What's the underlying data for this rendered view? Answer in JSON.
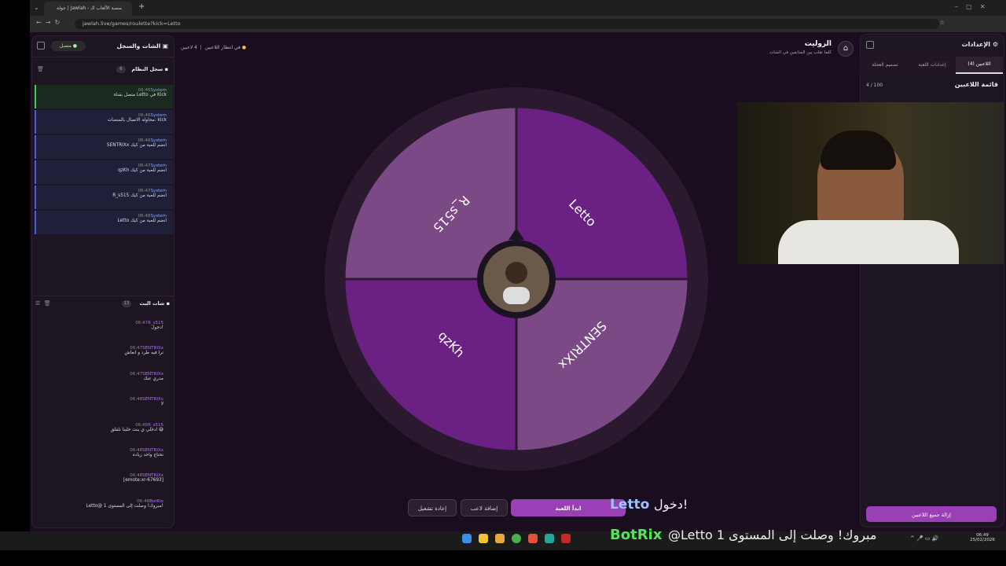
{
  "browser": {
    "tab_title": "جولة | Jawlah - منصة الألعاب الـ",
    "url": "jawlah.live/games/roulette?kick=Letto"
  },
  "left": {
    "title": "الشات والسجل",
    "status": "متصل",
    "system_log": {
      "title": "سجل النظام",
      "count": "6",
      "entries": [
        {
          "author": "System",
          "time": "06:46",
          "text": "متصل بقناة Letto في Kick"
        },
        {
          "author": "System",
          "time": "06:46",
          "text": "محاولة الاتصال بالمنصات: kick"
        },
        {
          "author": "System",
          "time": "06:46",
          "text": "SENTRIXx انضم للعبة من كيك"
        },
        {
          "author": "System",
          "time": "06:47",
          "text": "qzKh انضم للعبة من كيك"
        },
        {
          "author": "System",
          "time": "06:47",
          "text": "R_s515 انضم للعبة من كيك"
        },
        {
          "author": "System",
          "time": "06:48",
          "text": "Letto انضم للعبة من كيك"
        }
      ]
    },
    "live_chat": {
      "title": "شات البث",
      "count": "13",
      "messages": [
        {
          "user": "R_s515",
          "time": "06:47",
          "text": "دخول!"
        },
        {
          "user": "SENTRIXx",
          "time": "06:47",
          "text": "ترا فيه طرد و انعاش"
        },
        {
          "user": "SENTRIXx",
          "time": "06:47",
          "text": "مدري عنك"
        },
        {
          "user": "SENTRIXx",
          "time": "06:48",
          "text": "لا"
        },
        {
          "user": "R_s515",
          "time": "06:48",
          "text": "ادخلي ي بنت خلينا نلقلق 😅"
        },
        {
          "user": "SENTRIXx",
          "time": "06:48",
          "text": "نحتاج واحد زياده"
        },
        {
          "user": "SENTRIXx",
          "time": "06:48",
          "text": "[emote:xr-67693]"
        },
        {
          "user": "BotRix",
          "time": "06:48",
          "text": "Letto@ مبروك! وصلت إلى المستوى 1!"
        }
      ]
    }
  },
  "header": {
    "title": "الروليت",
    "subtitle": "كلما تقلب بين المتابعين في الشات",
    "players": "4 لاعبين",
    "waiting": "في انتظار اللاعبين"
  },
  "wheel": {
    "segments": [
      {
        "name": "Letto",
        "color": "#6b2183"
      },
      {
        "name": "SENTRIXx",
        "color": "#7b4a86"
      },
      {
        "name": "qzKh",
        "color": "#6b2183"
      },
      {
        "name": "R_s515",
        "color": "#7b4a86"
      }
    ]
  },
  "buttons": {
    "start": "ابدأ اللعبة",
    "add": "إضافة لاعب",
    "restart": "إعادة تشغيل",
    "remove_all": "إزالة جميع اللاعبين"
  },
  "right": {
    "title": "الإعدادات",
    "tabs": [
      "اللاعبين (4)",
      "إعدادات اللعبة",
      "تصميم العجلة"
    ],
    "list_title": "قائمة اللاعبين",
    "list_count": "4 / 100"
  },
  "overlay": {
    "line1_name": "Letto",
    "line1_text": "دخول!",
    "line2_bot": "BotRix",
    "line2_text": "@Letto 1 مبروك! وصلت إلى المستوى"
  },
  "taskbar": {
    "time": "06:49",
    "date": "25/02/2026"
  }
}
